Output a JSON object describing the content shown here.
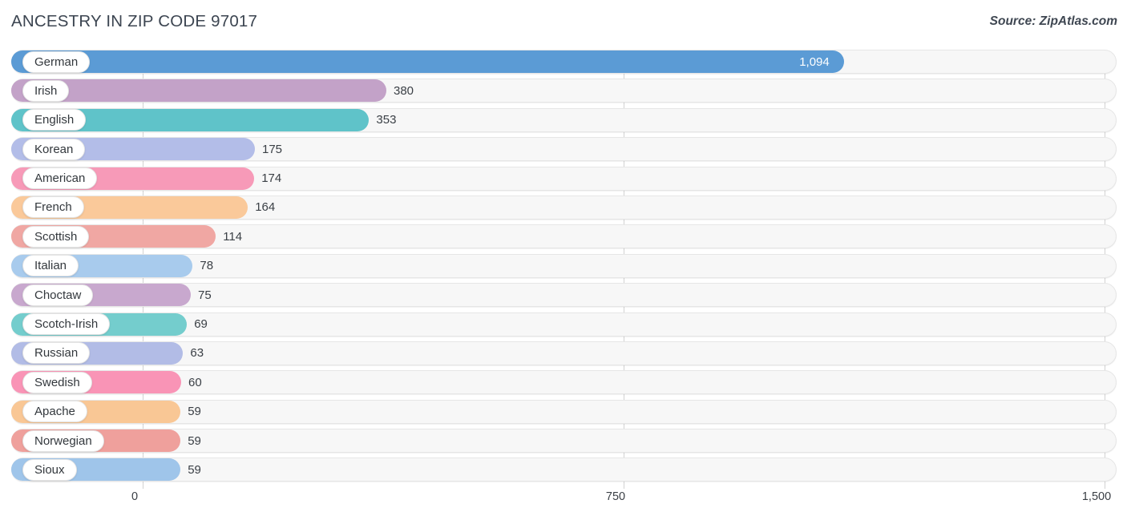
{
  "header": {
    "title": "ANCESTRY IN ZIP CODE 97017",
    "source": "Source: ZipAtlas.com"
  },
  "axis": {
    "ticks": [
      "0",
      "750",
      "1,500"
    ]
  },
  "chart_data": {
    "type": "bar",
    "orientation": "horizontal",
    "title": "ANCESTRY IN ZIP CODE 97017",
    "subtitle": "Source: ZipAtlas.com",
    "xlabel": "",
    "ylabel": "",
    "xlim": [
      0,
      1500
    ],
    "xticks": [
      0,
      750,
      1500
    ],
    "xtick_labels": [
      "0",
      "750",
      "1,500"
    ],
    "grid": true,
    "legend": "none",
    "categories": [
      "German",
      "Irish",
      "English",
      "Korean",
      "American",
      "French",
      "Scottish",
      "Italian",
      "Choctaw",
      "Scotch-Irish",
      "Russian",
      "Swedish",
      "Apache",
      "Norwegian",
      "Sioux"
    ],
    "values": [
      1094,
      380,
      353,
      175,
      174,
      164,
      114,
      78,
      75,
      69,
      63,
      60,
      59,
      59,
      59
    ],
    "value_labels": [
      "1,094",
      "380",
      "353",
      "175",
      "174",
      "164",
      "114",
      "78",
      "75",
      "69",
      "63",
      "60",
      "59",
      "59",
      "59"
    ],
    "colors": [
      "#5b9bd5",
      "#c3a2c8",
      "#5fc3c9",
      "#b3bde8",
      "#f79ab8",
      "#fac99a",
      "#f0a7a3",
      "#a8cbed",
      "#c8a8ce",
      "#74cdcd",
      "#b2bce6",
      "#f994b6",
      "#f9c795",
      "#ef a09c",
      "#9fc5ea"
    ],
    "bars": [
      {
        "label": "German",
        "value": 1094,
        "value_label": "1,094",
        "color": "#5b9bd5",
        "label_inside": true
      },
      {
        "label": "Irish",
        "value": 380,
        "value_label": "380",
        "color": "#c3a2c8",
        "label_inside": false
      },
      {
        "label": "English",
        "value": 353,
        "value_label": "353",
        "color": "#5fc3c9",
        "label_inside": false
      },
      {
        "label": "Korean",
        "value": 175,
        "value_label": "175",
        "color": "#b3bde8",
        "label_inside": false
      },
      {
        "label": "American",
        "value": 174,
        "value_label": "174",
        "color": "#f79ab8",
        "label_inside": false
      },
      {
        "label": "French",
        "value": 164,
        "value_label": "164",
        "color": "#fac99a",
        "label_inside": false
      },
      {
        "label": "Scottish",
        "value": 114,
        "value_label": "114",
        "color": "#f0a7a3",
        "label_inside": false
      },
      {
        "label": "Italian",
        "value": 78,
        "value_label": "78",
        "color": "#a8cbed",
        "label_inside": false
      },
      {
        "label": "Choctaw",
        "value": 75,
        "value_label": "75",
        "color": "#c8a8ce",
        "label_inside": false
      },
      {
        "label": "Scotch-Irish",
        "value": 69,
        "value_label": "69",
        "color": "#74cdcd",
        "label_inside": false
      },
      {
        "label": "Russian",
        "value": 63,
        "value_label": "63",
        "color": "#b2bce6",
        "label_inside": false
      },
      {
        "label": "Swedish",
        "value": 60,
        "value_label": "60",
        "color": "#f994b6",
        "label_inside": false
      },
      {
        "label": "Apache",
        "value": 59,
        "value_label": "59",
        "color": "#f9c795",
        "label_inside": false
      },
      {
        "label": "Norwegian",
        "value": 59,
        "value_label": "59",
        "color": "#efa09c",
        "label_inside": false
      },
      {
        "label": "Sioux",
        "value": 59,
        "value_label": "59",
        "color": "#9fc5ea",
        "label_inside": false
      }
    ]
  }
}
